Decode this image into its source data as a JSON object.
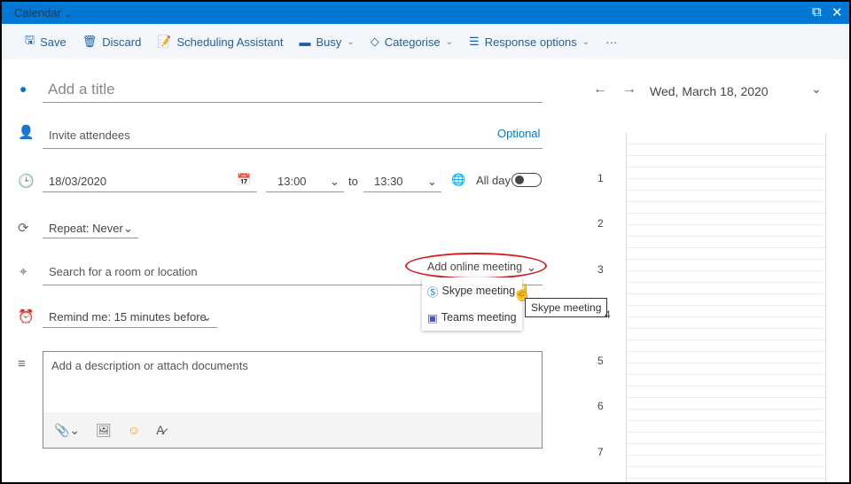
{
  "titlebar": {
    "title": "Calendar"
  },
  "toolbar": {
    "save": "Save",
    "discard": "Discard",
    "scheduling": "Scheduling Assistant",
    "busy": "Busy",
    "categorise": "Categorise",
    "response": "Response options",
    "more": "···"
  },
  "form": {
    "title_placeholder": "Add a title",
    "attendees_placeholder": "Invite attendees",
    "optional": "Optional",
    "date": "18/03/2020",
    "start": "13:00",
    "to": "to",
    "end": "13:30",
    "all_day": "All day",
    "all_day_on": false,
    "repeat": "Repeat: Never",
    "location_placeholder": "Search for a room or location",
    "online_meeting": "Add online meeting",
    "reminder": "Remind me: 15 minutes before",
    "description_placeholder": "Add a description or attach documents"
  },
  "menu": {
    "items": [
      {
        "label": "Skype meeting",
        "icon": "skype-icon"
      },
      {
        "label": "Teams meeting",
        "icon": "teams-icon"
      }
    ],
    "tooltip": "Skype meeting"
  },
  "calendar": {
    "date": "Wed, March 18, 2020",
    "hours": [
      "1",
      "2",
      "3",
      "4",
      "5",
      "6",
      "7"
    ]
  },
  "colors": {
    "accent": "#0078d4",
    "highlight": "#d42020"
  }
}
